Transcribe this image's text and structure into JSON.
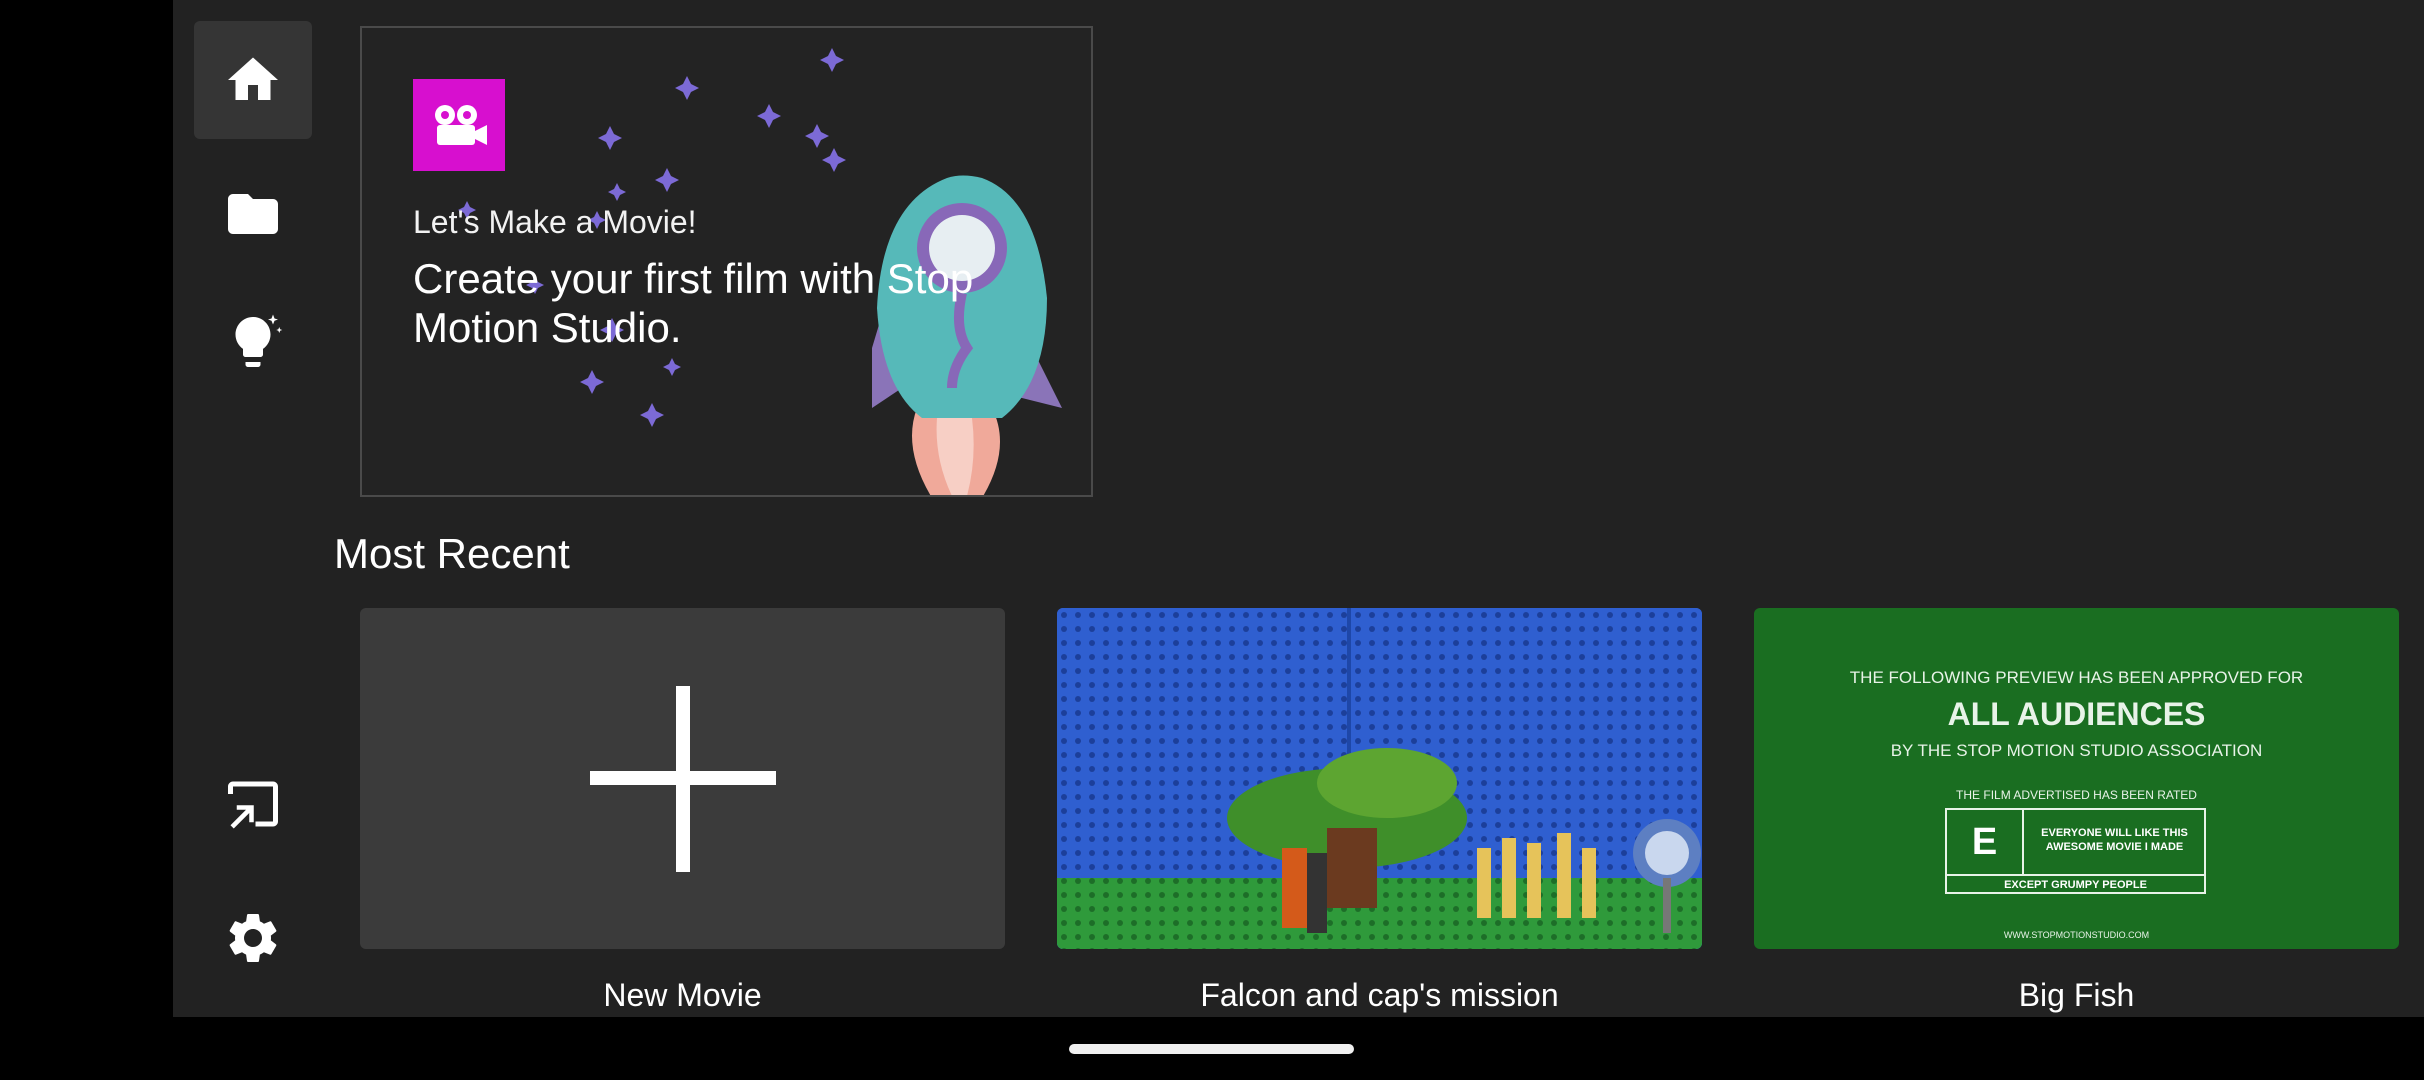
{
  "nav": {
    "items": [
      {
        "name": "home",
        "icon": "home-icon",
        "active": true
      },
      {
        "name": "projects",
        "icon": "folder-icon",
        "active": false
      },
      {
        "name": "ideas",
        "icon": "lightbulb-sparkle-icon",
        "active": false
      }
    ],
    "bottom_items": [
      {
        "name": "cast",
        "icon": "cast-icon"
      },
      {
        "name": "settings",
        "icon": "gear-icon"
      }
    ]
  },
  "banner": {
    "logo_icon": "movie-camera-icon",
    "logo_color": "#d70fcf",
    "kicker": "Let's Make a Movie!",
    "title": "Create your first film with Stop Motion Studio."
  },
  "recent": {
    "section_title": "Most Recent",
    "cards": [
      {
        "label": "New Movie",
        "icon": "plus-icon"
      },
      {
        "label": "Falcon and cap's mission"
      },
      {
        "label": "Big Fish",
        "rating": {
          "line1": "THE FOLLOWING PREVIEW HAS BEEN APPROVED FOR",
          "line2": "ALL AUDIENCES",
          "line3": "BY THE STOP MOTION STUDIO ASSOCIATION",
          "line4": "THE FILM ADVERTISED HAS BEEN RATED",
          "grade": "E",
          "desc1": "EVERYONE WILL LIKE THIS",
          "desc2": "AWESOME MOVIE I MADE",
          "footer": "EXCEPT GRUMPY PEOPLE",
          "url": "WWW.STOPMOTIONSTUDIO.COM"
        }
      }
    ]
  }
}
